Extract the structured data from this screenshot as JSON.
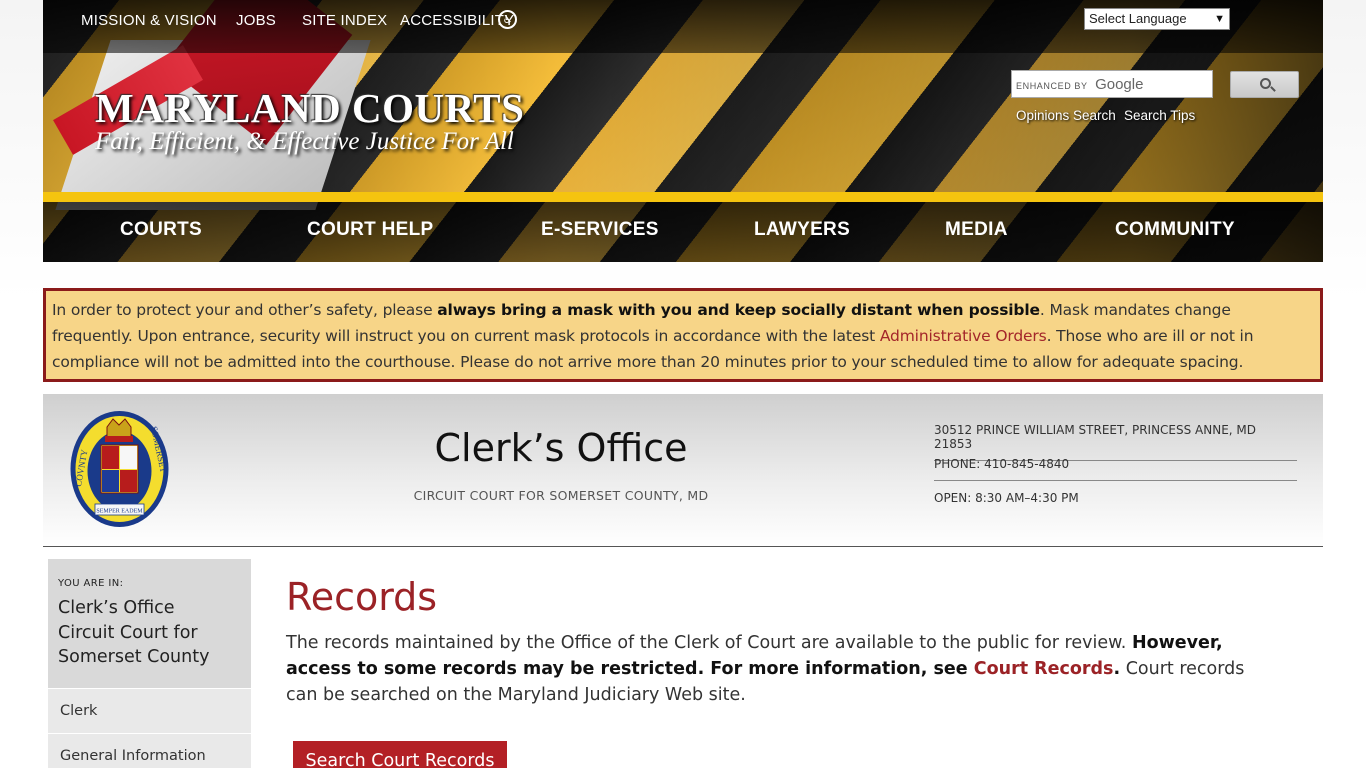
{
  "top_links": [
    "MISSION & VISION",
    "JOBS",
    "SITE INDEX",
    "ACCESSIBILITY"
  ],
  "language_select": "Select Language",
  "site": {
    "title": "MARYLAND COURTS",
    "tagline": "Fair, Efficient, & Effective Justice For All"
  },
  "search": {
    "enhanced_by": "ENHANCED BY",
    "provider": "Google",
    "links": [
      "Opinions Search",
      "Search Tips"
    ]
  },
  "nav": [
    "COURTS",
    "COURT HELP",
    "E-SERVICES",
    "LAWYERS",
    "MEDIA",
    "COMMUNITY"
  ],
  "alert": {
    "p1": "In order to protect your and other’s safety, please ",
    "bold": "always bring a mask with you and keep socially distant when possible",
    "p2": ". Mask mandates change frequently. Upon entrance, security will instruct you on current mask protocols in accordance with the latest ",
    "link": "Administrative Orders",
    "p3": ". Those who are ill or not in compliance will not be admitted into the courthouse. Please do not arrive more than 20 minutes prior to your scheduled time to allow for adequate spacing."
  },
  "office": {
    "title": "Clerk’s Office",
    "subtitle": "CIRCUIT COURT FOR SOMERSET COUNTY, MD",
    "address": "30512 PRINCE WILLIAM STREET, PRINCESS ANNE, MD 21853",
    "phone": "PHONE: 410-845-4840",
    "hours": "OPEN: 8:30 AM–4:30 PM",
    "seal_text_left": "COVNTY",
    "seal_text_right": "SOMERSET",
    "seal_motto": "SEMPER EADEM"
  },
  "sidebar": {
    "you_are_in": "YOU ARE IN:",
    "path": [
      "Clerk’s Office",
      "Circuit Court for",
      "Somerset County"
    ],
    "items": [
      "Clerk",
      "General Information"
    ]
  },
  "content": {
    "title": "Records",
    "p1": "The records maintained by the Office of the Clerk of Court are available to the public for review. ",
    "bold1": "However, access to some records may be restricted. For more information, see ",
    "link": "Court Records",
    "bold2": ".",
    "p2": " Court records can be searched on the Maryland Judiciary Web site.",
    "button": "Search Court Records"
  }
}
